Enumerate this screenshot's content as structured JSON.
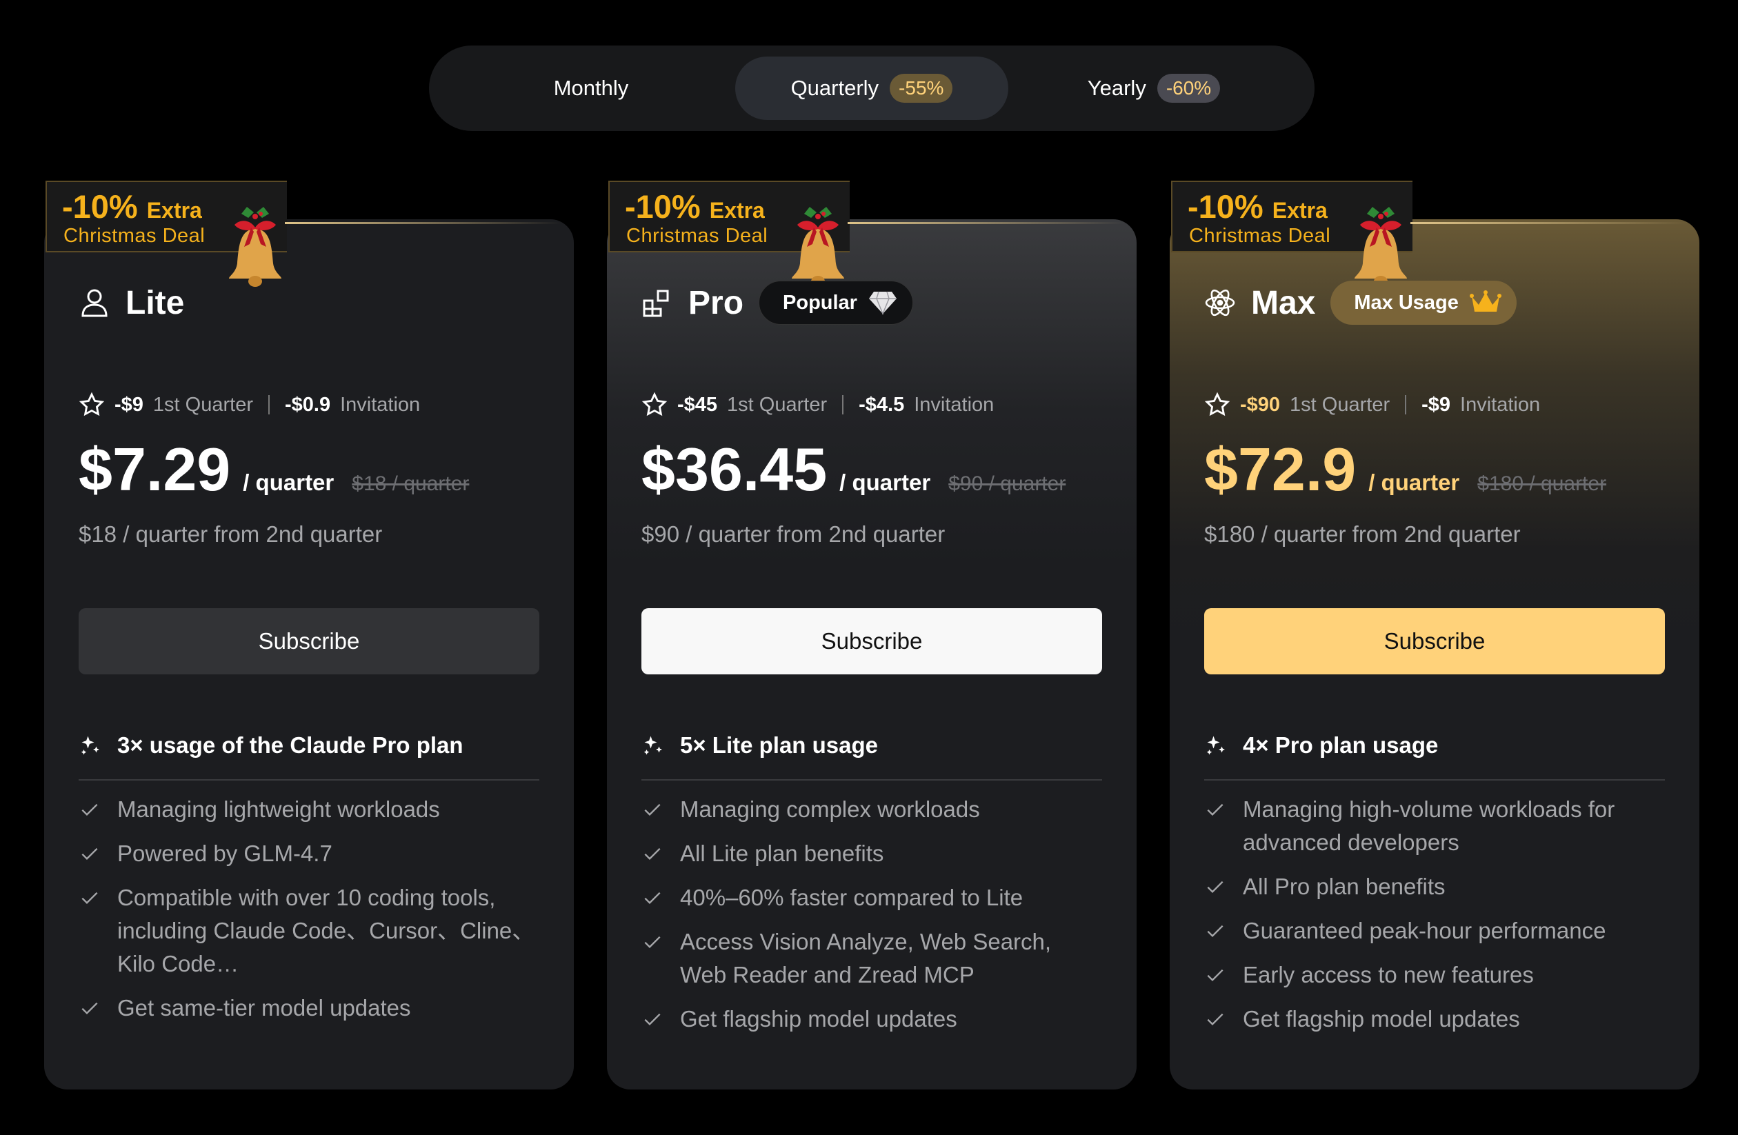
{
  "billing_toggle": {
    "monthly": "Monthly",
    "quarterly": "Quarterly",
    "quarterly_discount": "-55%",
    "yearly": "Yearly",
    "yearly_discount": "-60%",
    "selected": "Quarterly"
  },
  "promo": {
    "discount": "-10%",
    "extra": "Extra",
    "label": "Christmas Deal",
    "icon": "christmas-bell-icon"
  },
  "plans": [
    {
      "name": "Lite",
      "icon": "user-icon",
      "badge": "",
      "first_quarter_discount": "-$9",
      "first_quarter_label": "1st Quarter",
      "invitation_discount": "-$0.9",
      "invitation_label": "Invitation",
      "price": "$7.29",
      "period": "/ quarter",
      "original_price": "$18 / quarter",
      "renewal_note": "$18 / quarter from 2nd quarter",
      "subscribe_label": "Subscribe",
      "usage_headline": "3× usage of the Claude Pro plan",
      "features": [
        "Managing lightweight workloads",
        "Powered by GLM-4.7",
        "Compatible with over 10 coding tools, including Claude Code、Cursor、Cline、Kilo Code…",
        "Get same-tier model updates"
      ]
    },
    {
      "name": "Pro",
      "icon": "grid-icon",
      "badge": "Popular",
      "badge_icon": "diamond-icon",
      "first_quarter_discount": "-$45",
      "first_quarter_label": "1st Quarter",
      "invitation_discount": "-$4.5",
      "invitation_label": "Invitation",
      "price": "$36.45",
      "period": "/ quarter",
      "original_price": "$90 / quarter",
      "renewal_note": "$90 / quarter from 2nd quarter",
      "subscribe_label": "Subscribe",
      "usage_headline": "5× Lite plan usage",
      "features": [
        "Managing complex workloads",
        "All Lite plan benefits",
        "40%–60% faster compared to Lite",
        "Access Vision Analyze, Web Search, Web Reader and Zread MCP",
        "Get flagship model updates"
      ]
    },
    {
      "name": "Max",
      "icon": "atom-icon",
      "badge": "Max Usage",
      "badge_icon": "crown-icon",
      "first_quarter_discount": "-$90",
      "first_quarter_label": "1st Quarter",
      "invitation_discount": "-$9",
      "invitation_label": "Invitation",
      "price": "$72.9",
      "period": "/ quarter",
      "original_price": "$180 / quarter",
      "renewal_note": "$180 / quarter from 2nd quarter",
      "subscribe_label": "Subscribe",
      "usage_headline": "4× Pro plan usage",
      "features": [
        "Managing high-volume workloads for advanced developers",
        "All Pro plan benefits",
        "Guaranteed peak-hour performance",
        "Early access to new features",
        "Get flagship model updates"
      ]
    }
  ],
  "colors": {
    "accent_gold": "#ffd27a",
    "promo_orange": "#f6b21c",
    "card_bg": "#1c1d20",
    "muted_text": "#a6a7aa"
  }
}
